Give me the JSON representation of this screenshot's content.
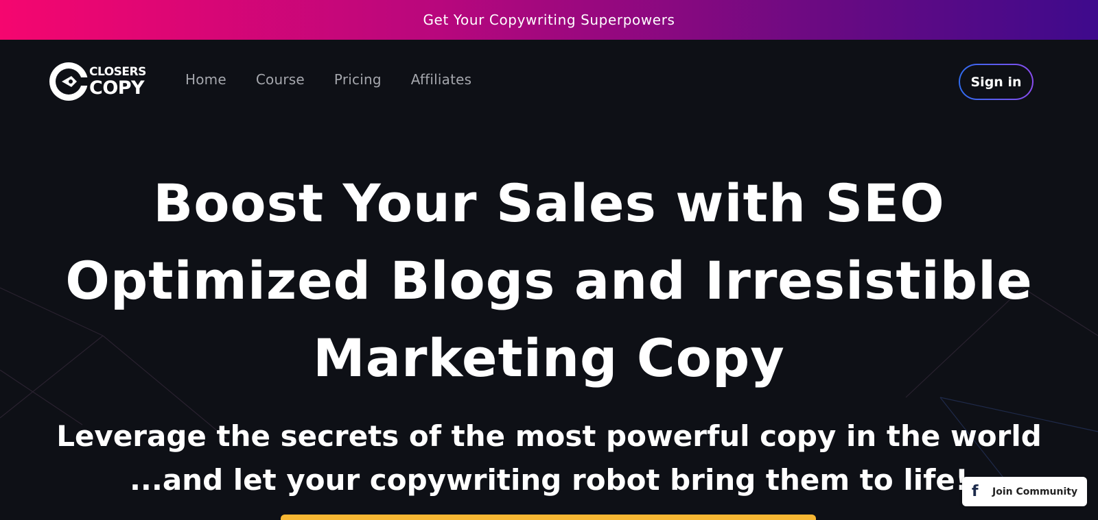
{
  "promo": {
    "text": "Get Your Copywriting Superpowers"
  },
  "logo": {
    "line1": "CLOSERS",
    "line2": "COPY"
  },
  "nav": {
    "items": [
      "Home",
      "Course",
      "Pricing",
      "Affiliates"
    ],
    "sign_in_label": "Sign in"
  },
  "hero": {
    "title_lines": [
      "Boost Your Sales with SEO",
      "Optimized Blogs and Irresistible",
      "Marketing Copy"
    ],
    "subtitle_lines": [
      "Leverage the secrets of the most powerful copy in the world",
      "...and let your copywriting robot bring them to life!"
    ]
  },
  "community": {
    "icon": "facebook-icon",
    "label": "Join Community"
  },
  "colors": {
    "background": "#0e1016",
    "promo_start": "#f5066f",
    "promo_end": "#3e0a8c",
    "nav_link": "#a5a7ad",
    "cta": "#f7b733"
  }
}
